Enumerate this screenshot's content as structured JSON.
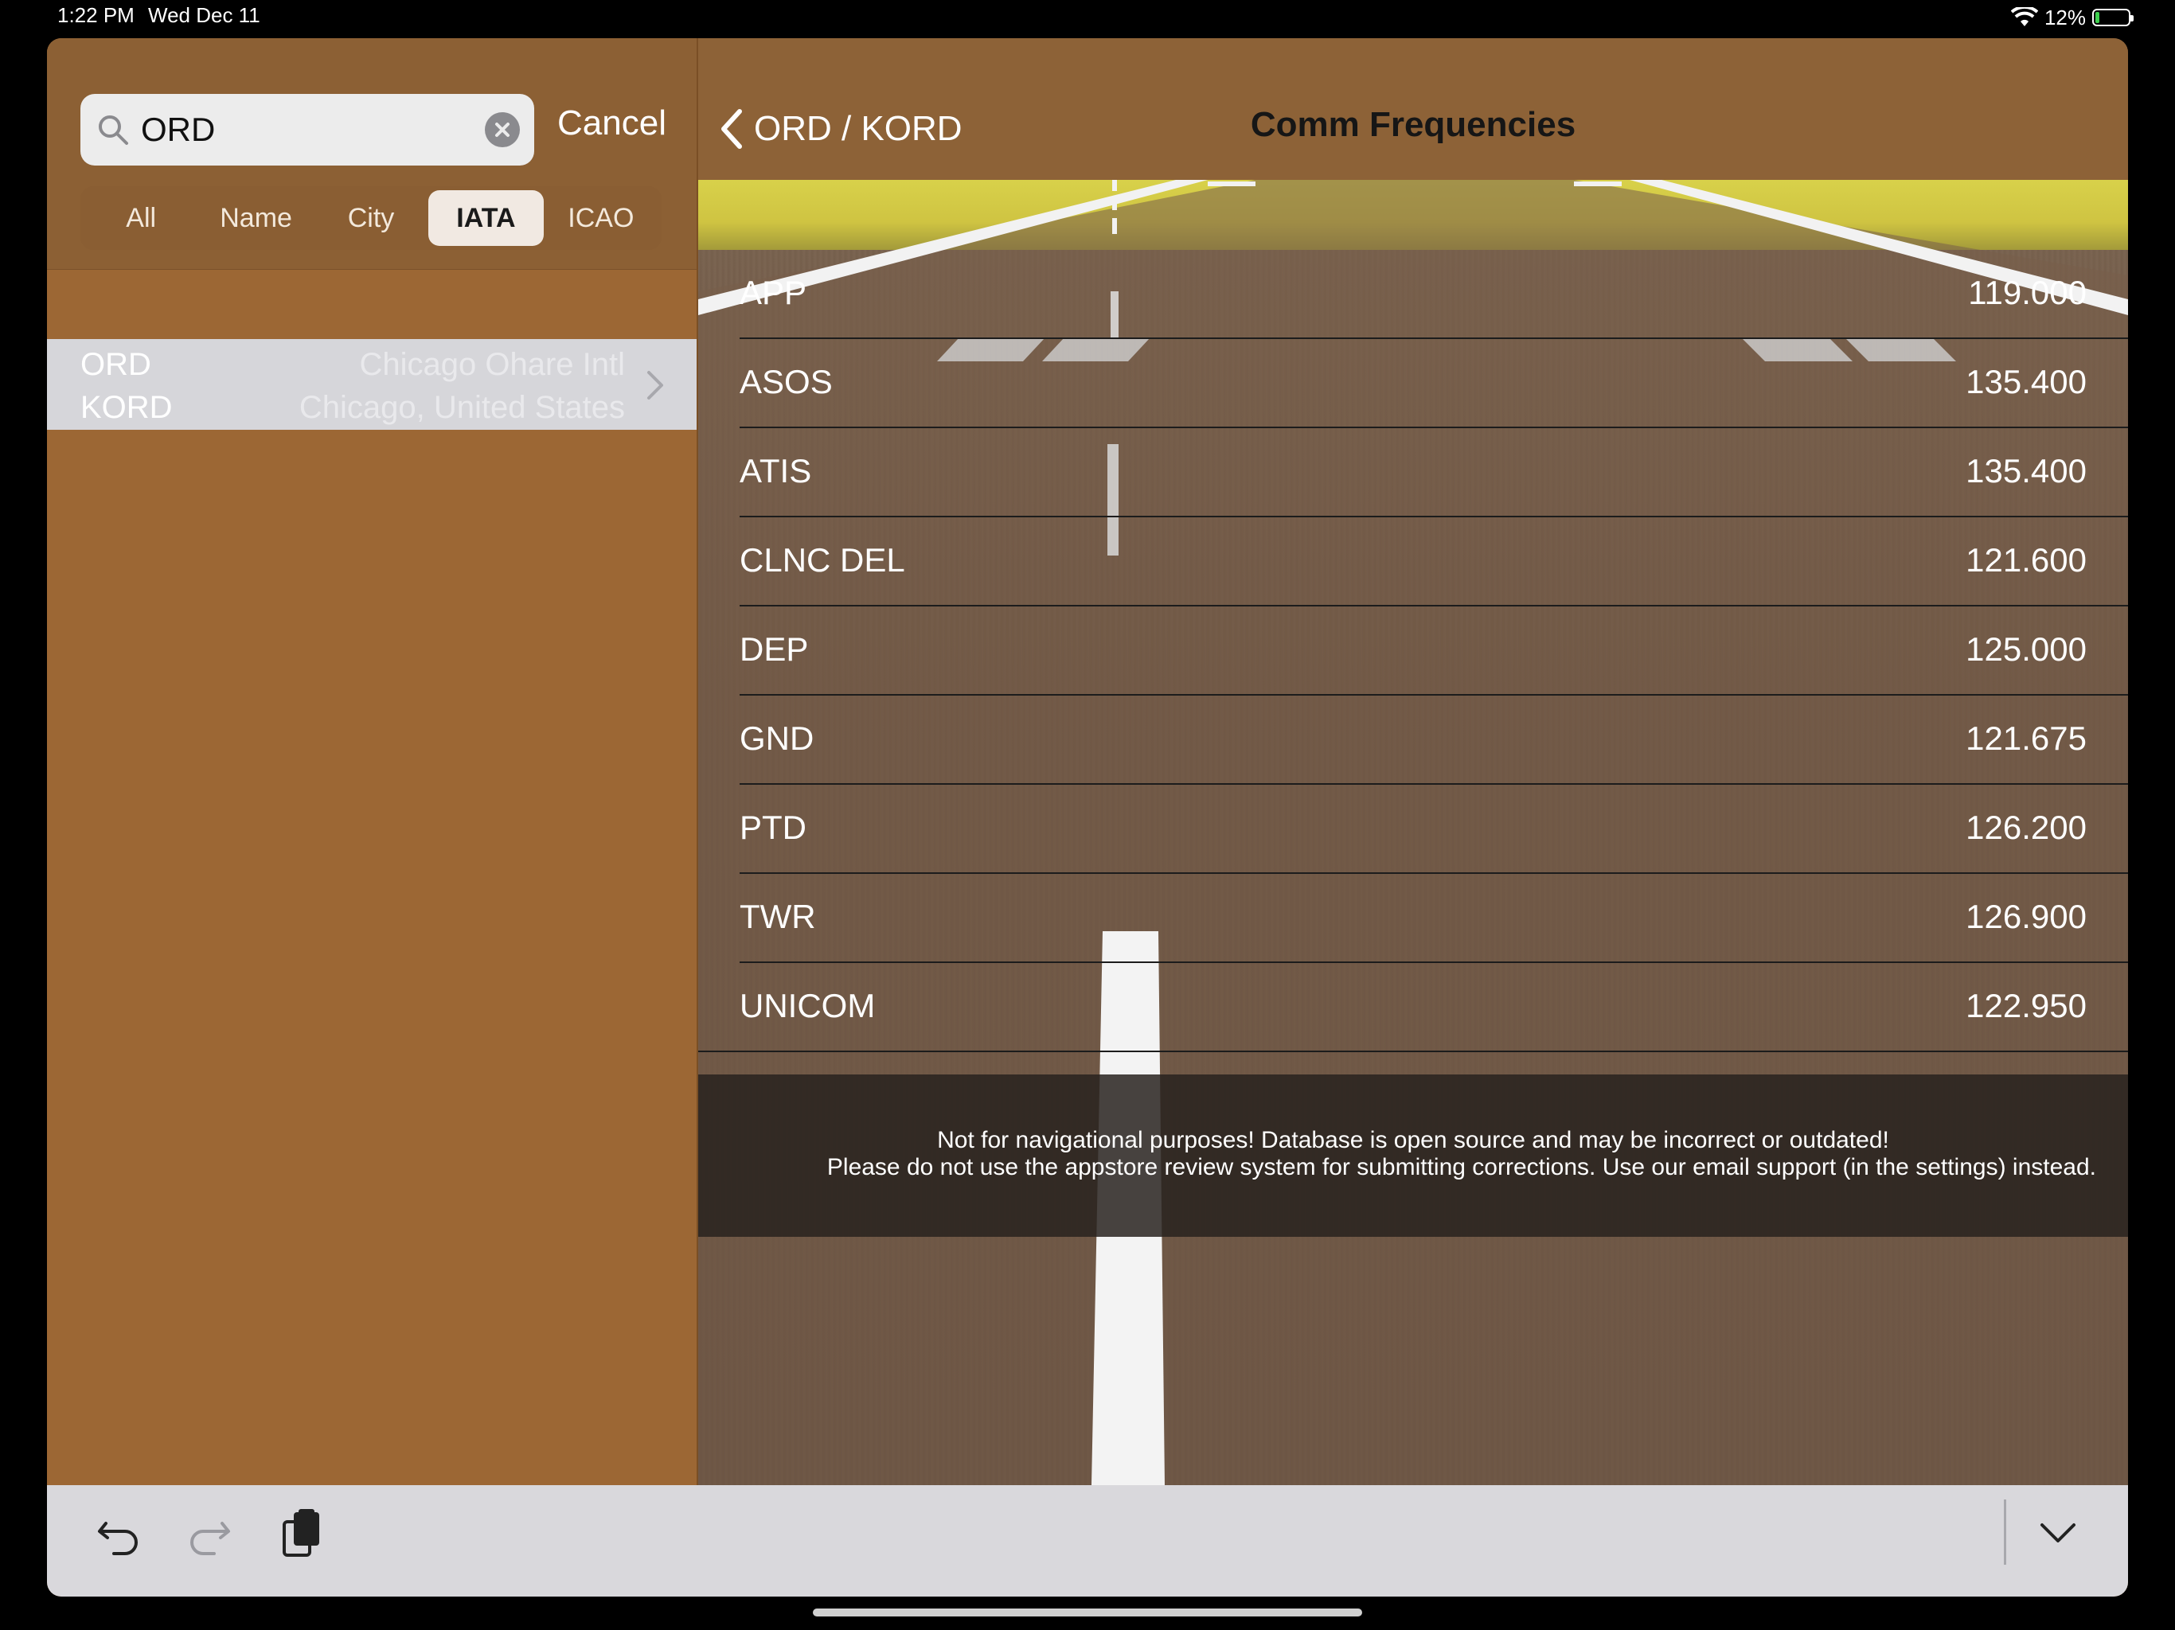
{
  "status_bar": {
    "time": "1:22 PM",
    "date": "Wed Dec 11",
    "battery": "12%",
    "battery_level": 0.12,
    "icons": [
      "wifi-icon",
      "battery-icon"
    ]
  },
  "search": {
    "value": "ORD",
    "cancel_label": "Cancel",
    "scopes": [
      "All",
      "Name",
      "City",
      "IATA",
      "ICAO"
    ],
    "selected_scope": "IATA"
  },
  "results": [
    {
      "iata": "ORD",
      "icao": "KORD",
      "name": "Chicago Ohare Intl",
      "city": "Chicago, United States"
    }
  ],
  "detail": {
    "back_label": "ORD / KORD",
    "title": "Comm Frequencies",
    "frequencies": [
      {
        "label": "APP",
        "value": "119.000"
      },
      {
        "label": "ASOS",
        "value": "135.400"
      },
      {
        "label": "ATIS",
        "value": "135.400"
      },
      {
        "label": "CLNC DEL",
        "value": "121.600"
      },
      {
        "label": "DEP",
        "value": "125.000"
      },
      {
        "label": "GND",
        "value": "121.675"
      },
      {
        "label": "PTD",
        "value": "126.200"
      },
      {
        "label": "TWR",
        "value": "126.900"
      },
      {
        "label": "UNICOM",
        "value": "122.950"
      }
    ],
    "disclaimer_line1": "Not for navigational purposes! Database is open source and may be incorrect or outdated!",
    "disclaimer_line2": "Please do not use the appstore review system for submitting corrections. Use our email support (in the settings) instead."
  },
  "toolbar": {
    "buttons": [
      "undo-icon",
      "redo-icon",
      "clipboard-icon",
      "chevron-down-icon"
    ]
  },
  "colors": {
    "pane_brown": "#9c6734",
    "header_brown": "#8d6237",
    "toolbar_gray": "#d9d8dc"
  }
}
